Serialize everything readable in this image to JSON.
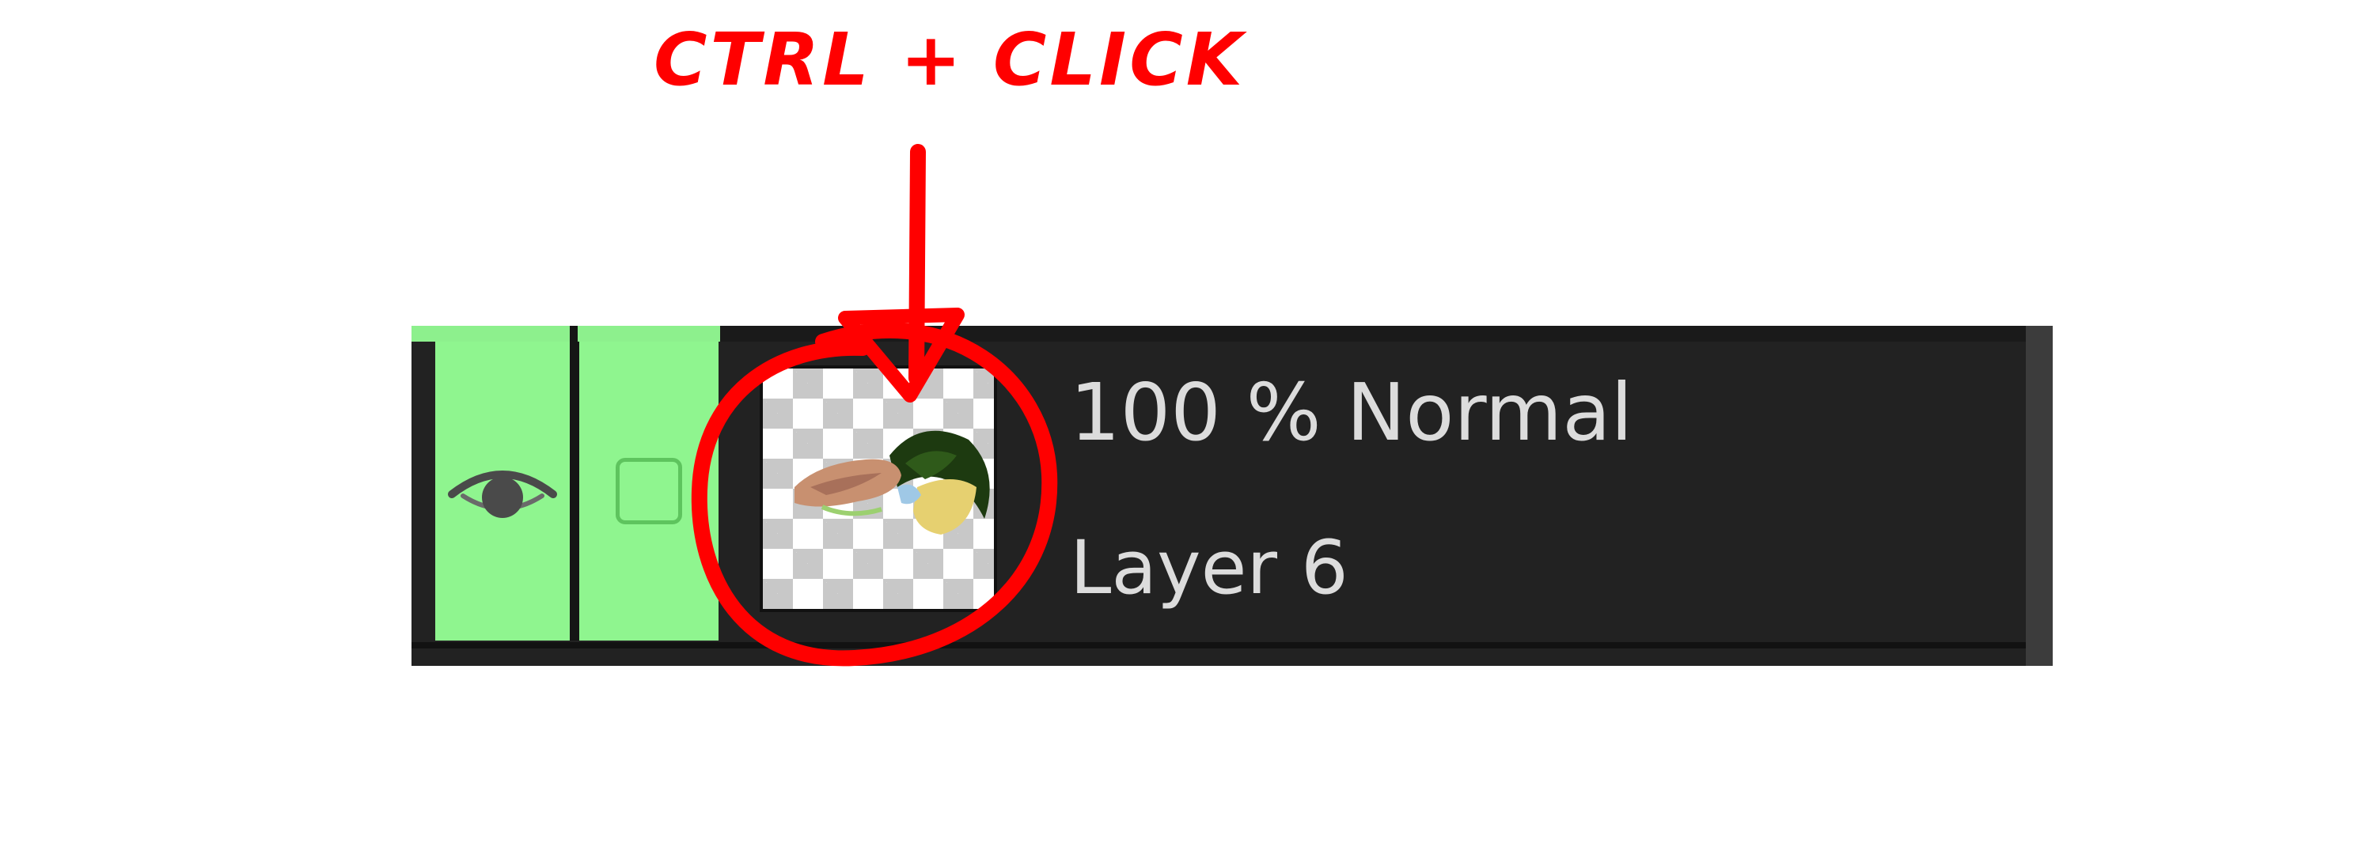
{
  "annotation": {
    "caption": "CTRL + CLICK",
    "color": "#ff0000"
  },
  "layer": {
    "opacity_blend": "100 % Normal",
    "name": "Layer 6",
    "visible": true,
    "locked": false,
    "highlight_color": "#8ff58f"
  },
  "icons": {
    "visibility": "eye-icon",
    "lock": "lock-toggle-icon",
    "arrow": "arrow-down-icon",
    "circle": "highlight-circle"
  }
}
